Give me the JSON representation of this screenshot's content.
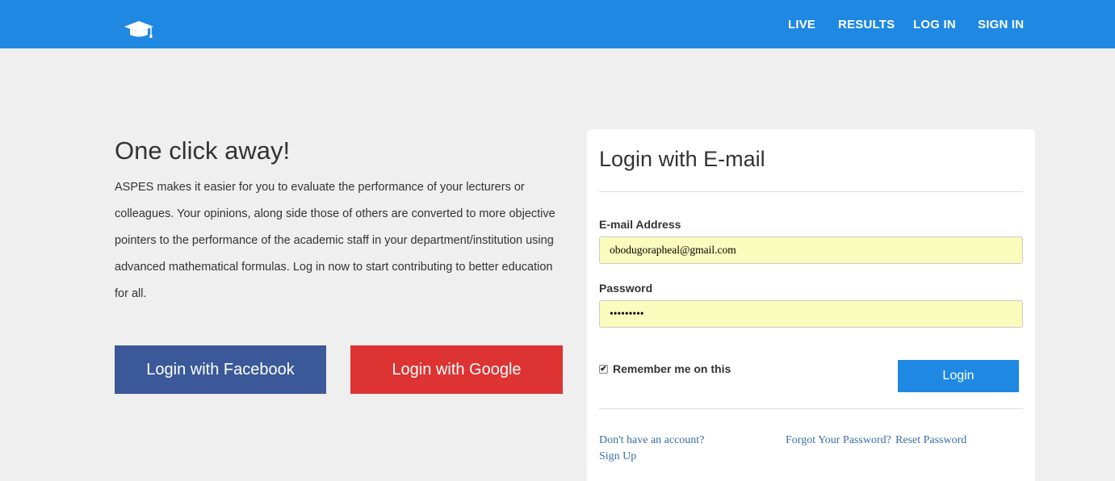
{
  "nav": {
    "logo_icon": "graduation-cap-icon",
    "items": [
      "LIVE",
      "RESULTS",
      "LOG IN",
      "SIGN IN"
    ]
  },
  "intro": {
    "title": "One click away!",
    "body": "ASPES makes it easier for you to evaluate the performance of your lecturers or colleagues. Your opinions, along side those of others are converted to more objective pointers to the performance of the academic staff in your department/institution using advanced mathematical formulas. Log in now to start contributing to better education for all."
  },
  "social": {
    "facebook_label": "Login with Facebook",
    "google_label": "Login with Google"
  },
  "login_form": {
    "title": "Login with E-mail",
    "email_label": "E-mail Address",
    "email_value": "obodugorapheal@gmail.com",
    "password_label": "Password",
    "password_value": "•••••••••",
    "remember_label": "Remember me on this",
    "remember_checked": true,
    "submit_label": "Login",
    "signup_prompt": "Don't have an account?",
    "signup_link": "Sign Up",
    "forgot_prompt": "Forgot Your Password?",
    "reset_link": "Reset Password"
  },
  "colors": {
    "navbar": "#1e88e2",
    "facebook": "#3b5998",
    "google": "#dd3333",
    "autofill": "#fafcbd"
  }
}
